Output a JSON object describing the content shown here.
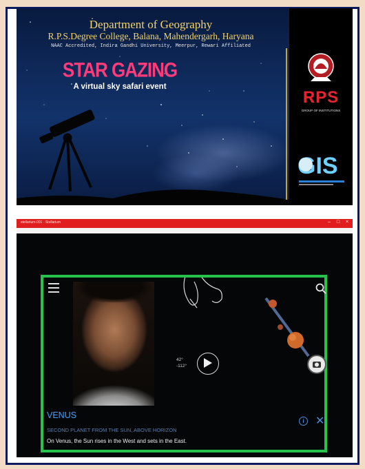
{
  "banner": {
    "department": "Department of Geography",
    "college": "R.P.S.Degree College, Balana, Mahendergarh, Haryana",
    "accreditation": "NAAC Accredited, Indira Gandhi University, Meerpur, Rewari Affiliated",
    "event_title": "STAR GAZING",
    "event_subtitle": "A virtual sky safari event",
    "logo_primary": "RPS",
    "logo_primary_sub": "GROUP OF INSTITUTIONS",
    "logo_secondary": "GIS"
  },
  "app": {
    "titlebar": "stellarium-001 - Stellarium",
    "menu": [
      "Media",
      "Playback",
      "Audio",
      "Video",
      "Subtitle",
      "Tools",
      "View",
      "Help"
    ],
    "sky_view": {
      "coord_alt": "42°",
      "coord_az": "-112°"
    },
    "object": {
      "name": "VENUS",
      "category": "SECOND PLANET FROM THE SUN, ABOVE HORIZON",
      "description": "On Venus, the Sun rises in the West and sets in the East."
    }
  },
  "colors": {
    "accent_frame": "#0d1a5e",
    "title_pink": "#ff3b7a",
    "window_red": "#e01e1e",
    "highlight_green": "#27c24c",
    "object_blue": "#3ea0ff"
  },
  "icons": {
    "menu": "hamburger-icon",
    "search": "search-icon",
    "camera": "camera-icon",
    "info": "info-icon",
    "close": "close-icon"
  }
}
